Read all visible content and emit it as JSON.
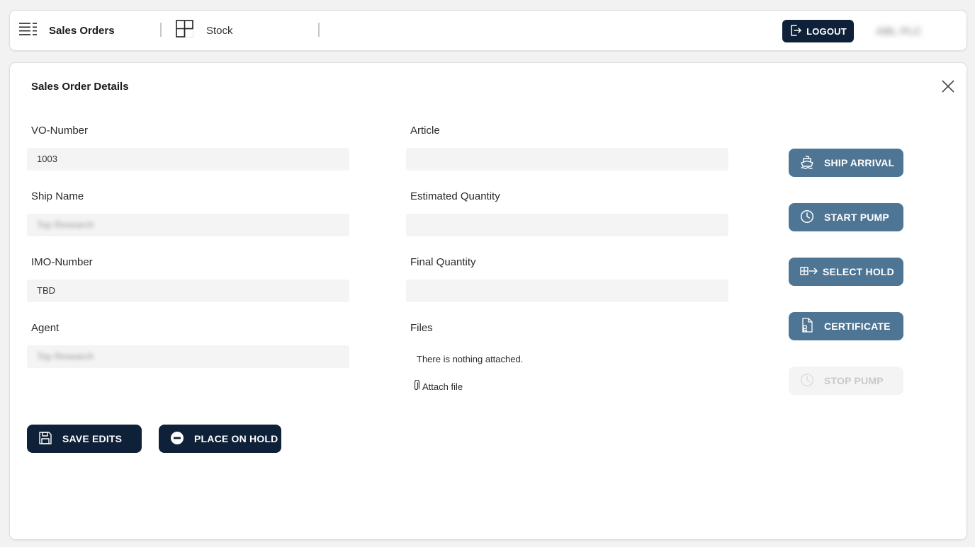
{
  "header": {
    "nav": [
      {
        "label": "Sales Orders",
        "icon": "list-icon"
      },
      {
        "label": "Stock",
        "icon": "grid-icon"
      }
    ],
    "logout_label": "LOGOUT",
    "user_name": "ABL PLC"
  },
  "panel": {
    "title": "Sales Order Details",
    "fields": {
      "vo_number": {
        "label": "VO-Number",
        "value": "1003"
      },
      "ship_name": {
        "label": "Ship Name",
        "value": "Top Research"
      },
      "imo_number": {
        "label": "IMO-Number",
        "value": "TBD"
      },
      "agent": {
        "label": "Agent",
        "value": "Top Research"
      },
      "article": {
        "label": "Article",
        "value": ""
      },
      "estimated_quantity": {
        "label": "Estimated Quantity",
        "value": ""
      },
      "final_quantity": {
        "label": "Final Quantity",
        "value": ""
      }
    },
    "files": {
      "label": "Files",
      "empty_text": "There is nothing attached.",
      "attach_label": "Attach file"
    },
    "actions": {
      "ship_arrival": "SHIP ARRIVAL",
      "start_pump": "START PUMP",
      "select_hold": "SELECT HOLD",
      "certificate": "CERTIFICATE",
      "stop_pump": "STOP PUMP"
    },
    "buttons": {
      "save_edits": "SAVE EDITS",
      "place_on_hold": "PLACE ON HOLD"
    }
  },
  "colors": {
    "primary_dark": "#0f2138",
    "action_blue": "#4e7594",
    "disabled_bg": "#f4f4f4",
    "disabled_text": "#c9c9c9",
    "input_bg": "#f4f4f4"
  }
}
